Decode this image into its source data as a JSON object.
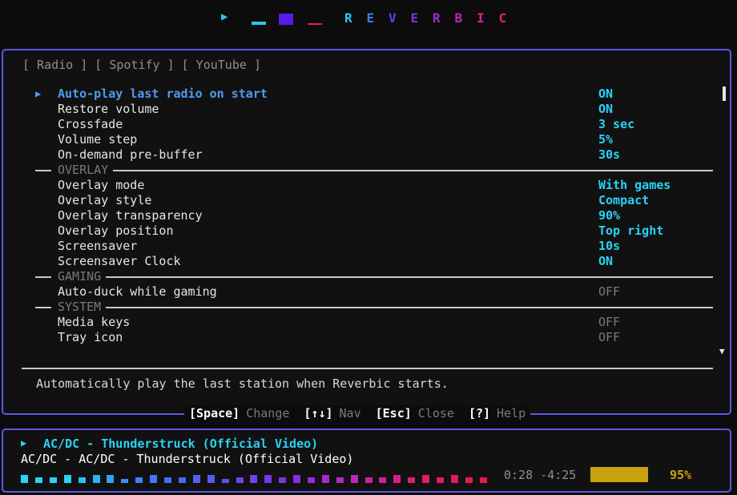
{
  "header": {
    "logo": {
      "play_glyph": "▶",
      "bars": [
        {
          "color": "#29c8f0",
          "level": 0.25
        },
        {
          "color": "#5a1ae6",
          "level": 1.0
        },
        {
          "color": "#e6196e",
          "level": 0.15
        }
      ]
    },
    "title_letters": [
      {
        "ch": "R",
        "color": "#29c8f0"
      },
      {
        "ch": "E",
        "color": "#3a7ef0"
      },
      {
        "ch": "V",
        "color": "#6a3cf0"
      },
      {
        "ch": "E",
        "color": "#7c2de6"
      },
      {
        "ch": "R",
        "color": "#9a2ad8"
      },
      {
        "ch": "B",
        "color": "#b828bf"
      },
      {
        "ch": "I",
        "color": "#d4249a"
      },
      {
        "ch": "C",
        "color": "#e61e60"
      }
    ]
  },
  "tabs": [
    {
      "label": "[ Radio ]"
    },
    {
      "label": "[ Spotify ]"
    },
    {
      "label": "[ YouTube ]"
    }
  ],
  "settings": [
    {
      "kind": "row",
      "label": "Auto-play last radio on start",
      "value": "ON",
      "state": "on",
      "selected": true
    },
    {
      "kind": "row",
      "label": "Restore volume",
      "value": "ON",
      "state": "on"
    },
    {
      "kind": "row",
      "label": "Crossfade",
      "value": "3 sec",
      "state": "on"
    },
    {
      "kind": "row",
      "label": "Volume step",
      "value": "5%",
      "state": "on"
    },
    {
      "kind": "row",
      "label": "On-demand pre-buffer",
      "value": "30s",
      "state": "on"
    },
    {
      "kind": "section",
      "label": "OVERLAY"
    },
    {
      "kind": "row",
      "label": "Overlay mode",
      "value": "With games",
      "state": "on"
    },
    {
      "kind": "row",
      "label": "Overlay style",
      "value": "Compact",
      "state": "on"
    },
    {
      "kind": "row",
      "label": "Overlay transparency",
      "value": "90%",
      "state": "on"
    },
    {
      "kind": "row",
      "label": "Overlay position",
      "value": "Top right",
      "state": "on"
    },
    {
      "kind": "row",
      "label": "Screensaver",
      "value": "10s",
      "state": "on"
    },
    {
      "kind": "row",
      "label": "Screensaver Clock",
      "value": "ON",
      "state": "on"
    },
    {
      "kind": "section",
      "label": "GAMING"
    },
    {
      "kind": "row",
      "label": "Auto-duck while gaming",
      "value": "OFF",
      "state": "off"
    },
    {
      "kind": "section",
      "label": "SYSTEM"
    },
    {
      "kind": "row",
      "label": "Media keys",
      "value": "OFF",
      "state": "off"
    },
    {
      "kind": "row",
      "label": "Tray icon",
      "value": "OFF",
      "state": "off"
    }
  ],
  "selected_arrow": "▶",
  "scroll_down_glyph": "▼",
  "description": "Automatically play the last station when Reverbic starts.",
  "keys": [
    {
      "key": "[Space]",
      "action": "Change"
    },
    {
      "key": "[↑↓]",
      "action": "Nav"
    },
    {
      "key": "[Esc]",
      "action": "Close"
    },
    {
      "key": "[?]",
      "action": "Help"
    }
  ],
  "now_playing": {
    "arrow": "▶",
    "title": "AC/DC - Thunderstruck (Official Video)",
    "subtitle": "AC/DC - AC/DC - Thunderstruck (Official Video)",
    "elapsed": "0:28",
    "remaining": "-4:25",
    "time_text": "0:28 -4:25",
    "volume_pct": "95%",
    "volume_level": 0.95,
    "visualizer": [
      {
        "level": 0.85,
        "color": "#29d3f5"
      },
      {
        "level": 0.6,
        "color": "#29d3f5"
      },
      {
        "level": 0.6,
        "color": "#29d3f5"
      },
      {
        "level": 0.85,
        "color": "#29d3f5"
      },
      {
        "level": 0.6,
        "color": "#2ac0f5"
      },
      {
        "level": 0.85,
        "color": "#2cb0f5"
      },
      {
        "level": 0.85,
        "color": "#2ea4f5"
      },
      {
        "level": 0.45,
        "color": "#3a8ef5"
      },
      {
        "level": 0.6,
        "color": "#3c84f5"
      },
      {
        "level": 0.85,
        "color": "#3e78f5"
      },
      {
        "level": 0.6,
        "color": "#4070f2"
      },
      {
        "level": 0.6,
        "color": "#4868f0"
      },
      {
        "level": 0.85,
        "color": "#5060ee"
      },
      {
        "level": 0.85,
        "color": "#5858ec"
      },
      {
        "level": 0.45,
        "color": "#6050ea"
      },
      {
        "level": 0.6,
        "color": "#6a48e8"
      },
      {
        "level": 0.85,
        "color": "#7040e8"
      },
      {
        "level": 0.85,
        "color": "#7838e6"
      },
      {
        "level": 0.6,
        "color": "#8032e4"
      },
      {
        "level": 0.85,
        "color": "#8830e0"
      },
      {
        "level": 0.6,
        "color": "#9a2cd8"
      },
      {
        "level": 0.85,
        "color": "#a82ad0"
      },
      {
        "level": 0.6,
        "color": "#b228c4"
      },
      {
        "level": 0.85,
        "color": "#bc26b8"
      },
      {
        "level": 0.6,
        "color": "#c624a8"
      },
      {
        "level": 0.6,
        "color": "#ce2298"
      },
      {
        "level": 0.85,
        "color": "#d62088"
      },
      {
        "level": 0.6,
        "color": "#dc1e7a"
      },
      {
        "level": 0.85,
        "color": "#e01c6c"
      },
      {
        "level": 0.6,
        "color": "#e41a62"
      },
      {
        "level": 0.85,
        "color": "#e6195a"
      },
      {
        "level": 0.6,
        "color": "#e81852"
      },
      {
        "level": 0.6,
        "color": "#e8184e"
      }
    ]
  },
  "colors": {
    "accent": "#5a5ae6",
    "on_value": "#29d3f5",
    "selected_label": "#4f9cf5",
    "off_value": "#7a7a7a",
    "volume": "#c9a10c"
  }
}
